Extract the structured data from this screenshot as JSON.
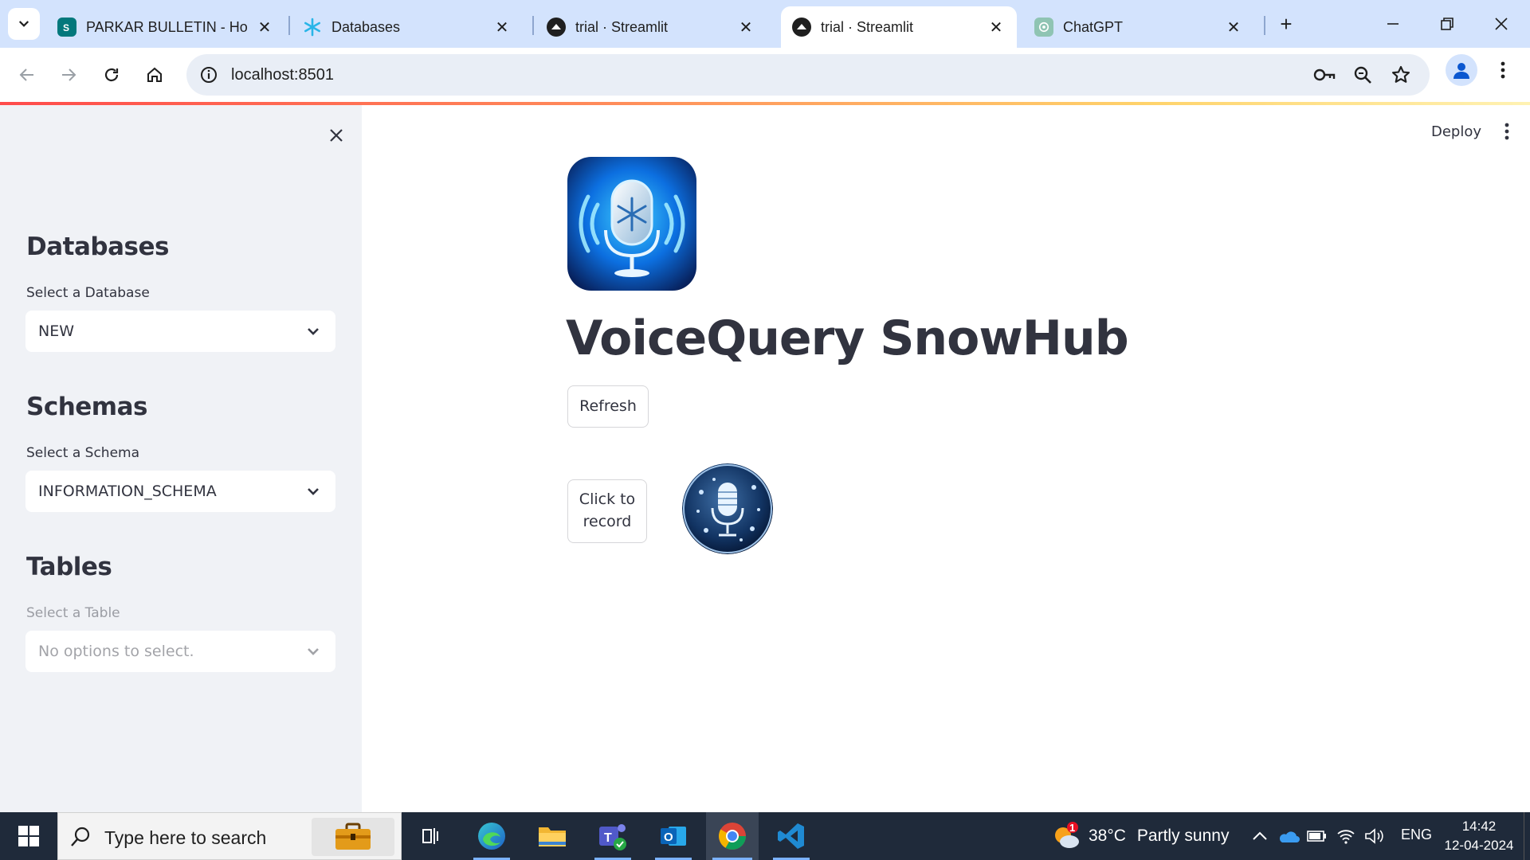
{
  "browser": {
    "tabs": [
      {
        "title": "PARKAR BULLETIN - Hom",
        "icon": "sharepoint-icon",
        "active": false
      },
      {
        "title": "Databases",
        "icon": "snowflake-icon",
        "active": false
      },
      {
        "title": "trial · Streamlit",
        "icon": "streamlit-icon",
        "active": false
      },
      {
        "title": "trial · Streamlit",
        "icon": "streamlit-icon",
        "active": true
      },
      {
        "title": "ChatGPT",
        "icon": "chatgpt-icon",
        "active": false
      }
    ],
    "url": "localhost:8501"
  },
  "sidebar": {
    "sections": [
      {
        "heading": "Databases",
        "label": "Select a Database",
        "value": "NEW",
        "disabled": false
      },
      {
        "heading": "Schemas",
        "label": "Select a Schema",
        "value": "INFORMATION_SCHEMA",
        "disabled": false
      },
      {
        "heading": "Tables",
        "label": "Select a Table",
        "value": "No options to select.",
        "disabled": true
      }
    ]
  },
  "main": {
    "deploy_label": "Deploy",
    "title": "VoiceQuery SnowHub",
    "refresh_label": "Refresh",
    "record_label": "Click to record"
  },
  "taskbar": {
    "search_placeholder": "Type here to search",
    "weather": {
      "temperature": "38°C",
      "condition": "Partly sunny",
      "badge": "1"
    },
    "language": "ENG",
    "time": "14:42",
    "date": "12-04-2024"
  },
  "colors": {
    "accent_red": "#ff4b4b",
    "sidebar_bg": "#f0f2f6",
    "text": "#31333f",
    "tabstrip_bg": "#d3e3fd",
    "taskbar_bg": "#1f2a3a"
  }
}
